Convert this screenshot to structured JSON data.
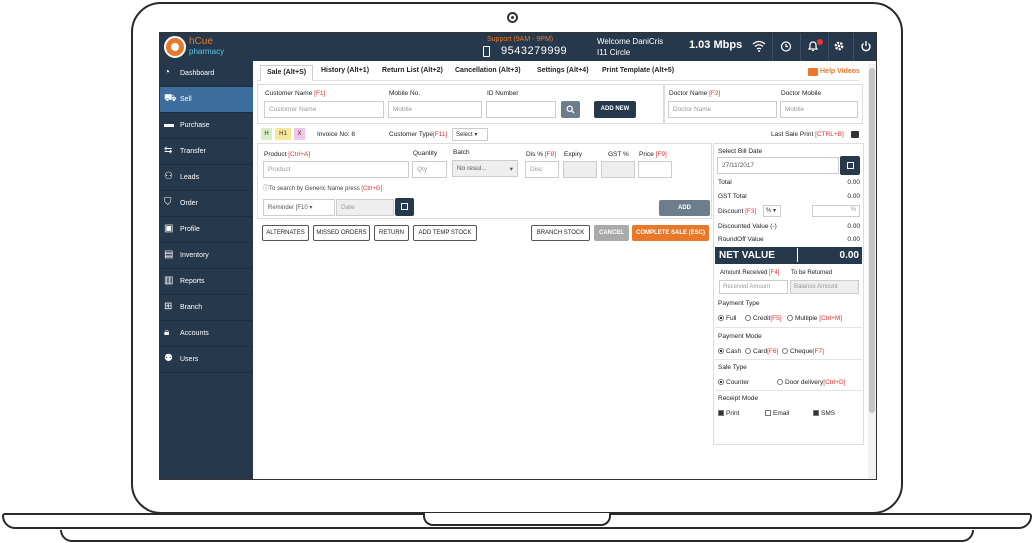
{
  "topbar": {
    "brand_name": "hCue",
    "brand_sub": "pharmacy",
    "support": "Support (9AM - 9PM)",
    "phone": "9543279999",
    "welcome": "Welcome DaniCris",
    "location": "I11 Circle",
    "speed": "1.03 Mbps"
  },
  "sidebar": {
    "items": [
      {
        "label": "Dashboard",
        "icon": "dashboard-icon"
      },
      {
        "label": "Sell",
        "icon": "cart-icon"
      },
      {
        "label": "Purchase",
        "icon": "purchase-icon"
      },
      {
        "label": "Transfer",
        "icon": "transfer-icon"
      },
      {
        "label": "Leads",
        "icon": "leads-icon"
      },
      {
        "label": "Order",
        "icon": "order-icon"
      },
      {
        "label": "Profile",
        "icon": "profile-icon"
      },
      {
        "label": "Inventory",
        "icon": "inventory-icon"
      },
      {
        "label": "Reports",
        "icon": "reports-icon"
      },
      {
        "label": "Branch",
        "icon": "branch-icon"
      },
      {
        "label": "Accounts",
        "icon": "lock-icon"
      },
      {
        "label": "Users",
        "icon": "users-icon"
      }
    ]
  },
  "tabs": {
    "sale": "Sale (Alt+S)",
    "history": "History (Alt+1)",
    "return_list": "Return List (Alt+2)",
    "cancellation": "Cancellation (Alt+3)",
    "settings": "Settings (Alt+4)",
    "print_template": "Print Template (Alt+5)",
    "help": "Help Videos"
  },
  "customer": {
    "name_label": "Customer Name",
    "name_key": "[F1]",
    "name_placeholder": "Customer Name",
    "mobile_label": "Mobile No.",
    "mobile_placeholder": "Mobile",
    "id_label": "ID Number",
    "add_new": "ADD NEW"
  },
  "doctor": {
    "name_label": "Doctor Name",
    "name_key": "[F2]",
    "name_placeholder": "Doctor Name",
    "mobile_label": "Doctor Mobile",
    "mobile_placeholder": "Mobile"
  },
  "invoice": {
    "chips": [
      "H",
      "H1",
      "X"
    ],
    "number": "Invoice No: 8",
    "customer_type_label": "Customer Type",
    "customer_type_key": "[F11]",
    "customer_type_value": "Select",
    "last_sale": "Last Sale Print",
    "last_sale_key": "[CTRL+B]"
  },
  "product": {
    "product_label": "Product",
    "product_key": "[Ctrl+A]",
    "product_placeholder": "Product",
    "qty_label": "Quantity",
    "qty_placeholder": "Qty",
    "batch_label": "Batch",
    "batch_value": "No resul...",
    "dis_label": "Dis %",
    "dis_key": "[F8]",
    "dis_placeholder": "Disc",
    "expiry_label": "Expiry",
    "gst_label": "GST %",
    "price_label": "Price",
    "price_key": "[F9]",
    "hint": "To search by Generic Name press",
    "hint_key": "[Ctrl+G]",
    "reminder": "Reminder [F10",
    "date_placeholder": "Date",
    "add": "ADD"
  },
  "actions": {
    "alternates": "ALTERNATES",
    "missed_orders": "MISSED ORDERS",
    "return": "RETURN",
    "add_temp_stock": "ADD TEMP STOCK",
    "branch_stock": "BRANCH STOCK",
    "cancel": "CANCEL",
    "complete_sale": "COMPLETE SALE (ESC)"
  },
  "summary": {
    "bill_date_label": "Select Bill Date",
    "bill_date": "27/11/2017",
    "total_label": "Total",
    "total": "0.00",
    "gst_label": "GST Total",
    "gst": "0.00",
    "discount_label": "Discount",
    "discount_key": "[F3]",
    "discount_type": "%",
    "discount_placeholder": "%",
    "discounted_label": "Discounted Value (-)",
    "discounted": "0.00",
    "roundoff_label": "RoundOff Value",
    "roundoff": "0.00",
    "net_label": "NET VALUE",
    "net": "0.00",
    "received_label": "Amount Received",
    "received_key": "[F4]",
    "returned_label": "To be Returned",
    "received_placeholder": "Received Amount",
    "balance_placeholder": "Balance Amount",
    "payment_type_label": "Payment Type",
    "pt_full": "Full",
    "pt_credit": "Credit",
    "pt_credit_key": "[F5]",
    "pt_multiple": "Multiple",
    "pt_multiple_key": "[Ctrl+M]",
    "payment_mode_label": "Payment Mode",
    "pm_cash": "Cash",
    "pm_card": "Card",
    "pm_card_key": "[F6]",
    "pm_cheque": "Cheque",
    "pm_cheque_key": "[F7]",
    "sale_type_label": "Sale Type",
    "st_counter": "Counter",
    "st_door": "Door delivery",
    "st_door_key": "[Ctrl+D]",
    "receipt_mode_label": "Receipt Mode",
    "rm_print": "Print",
    "rm_email": "Email",
    "rm_sms": "SMS"
  },
  "colors": {
    "navy": "#26384c",
    "accent": "#e8792b",
    "active": "#3b6e9c"
  }
}
